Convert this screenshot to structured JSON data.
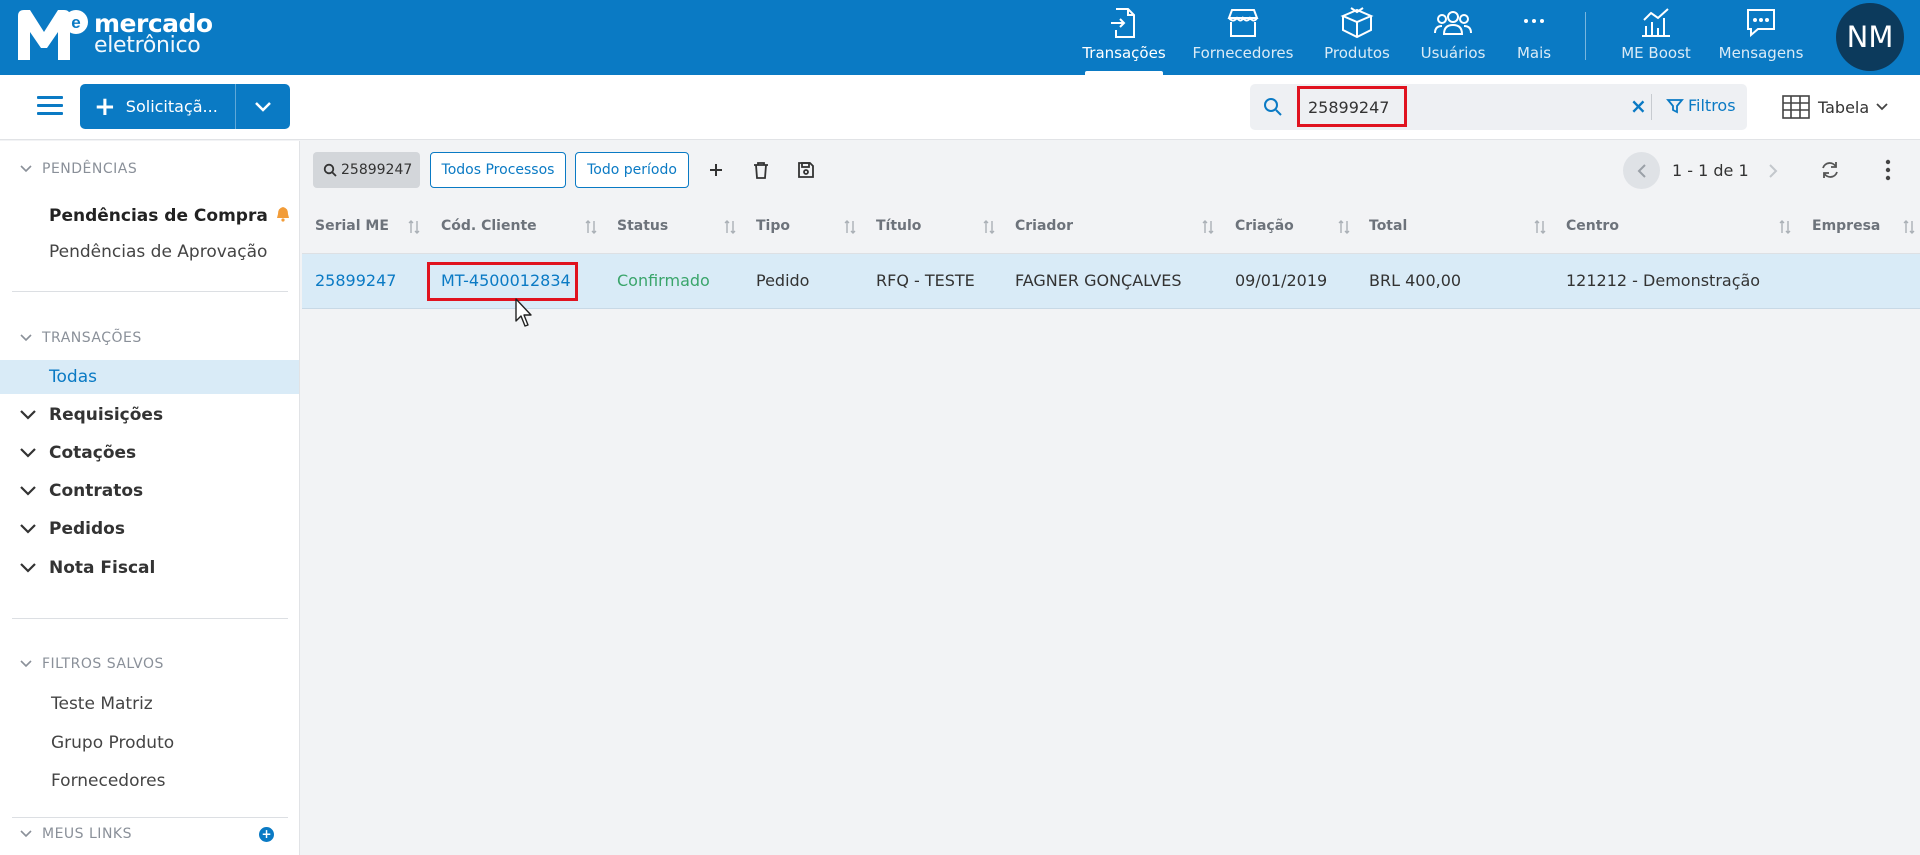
{
  "logo": {
    "line1": "mercado",
    "line2": "eletrônico"
  },
  "nav": [
    {
      "label": "Transações",
      "icon": "transactions-icon"
    },
    {
      "label": "Fornecedores",
      "icon": "store-icon"
    },
    {
      "label": "Produtos",
      "icon": "box-icon"
    },
    {
      "label": "Usuários",
      "icon": "users-icon"
    },
    {
      "label": "Mais",
      "icon": "more-icon"
    },
    {
      "label": "ME Boost",
      "icon": "chart-icon"
    },
    {
      "label": "Mensagens",
      "icon": "message-icon"
    }
  ],
  "user": {
    "initials": "NM"
  },
  "toolbar": {
    "new_button_label": "Solicitaçã...",
    "search_value": "25899247",
    "filters_label": "Filtros",
    "view_label": "Tabela"
  },
  "sidebar": {
    "pendencias_header": "PENDÊNCIAS",
    "pendencias_items": [
      "Pendências de Compra",
      "Pendências de Aprovação"
    ],
    "transacoes_header": "TRANSAÇÕES",
    "todas_label": "Todas",
    "groups": [
      "Requisições",
      "Cotações",
      "Contratos",
      "Pedidos",
      "Nota Fiscal"
    ],
    "filtros_header": "FILTROS SALVOS",
    "saved_filters": [
      "Teste Matriz",
      "Grupo Produto",
      "Fornecedores"
    ],
    "links_header": "MEUS LINKS"
  },
  "chips": {
    "search_chip": "25899247",
    "process_chip": "Todos Processos",
    "period_chip": "Todo período"
  },
  "pager": {
    "text": "1 - 1 de 1"
  },
  "table": {
    "headers": [
      "Serial ME",
      "Cód. Cliente",
      "Status",
      "Tipo",
      "Título",
      "Criador",
      "Criação",
      "Total",
      "Centro",
      "Empresa"
    ],
    "rows": [
      {
        "serial": "25899247",
        "cliente": "MT-4500012834",
        "status": "Confirmado",
        "tipo": "Pedido",
        "titulo": "RFQ - TESTE",
        "criador": "FAGNER GONÇALVES",
        "criacao": "09/01/2019",
        "total": "BRL 400,00",
        "centro": "121212 - Demonstração",
        "empresa": ""
      }
    ]
  },
  "colors": {
    "primary": "#0a7ac4",
    "highlight": "#e0131f",
    "status_green": "#3aa56b"
  }
}
